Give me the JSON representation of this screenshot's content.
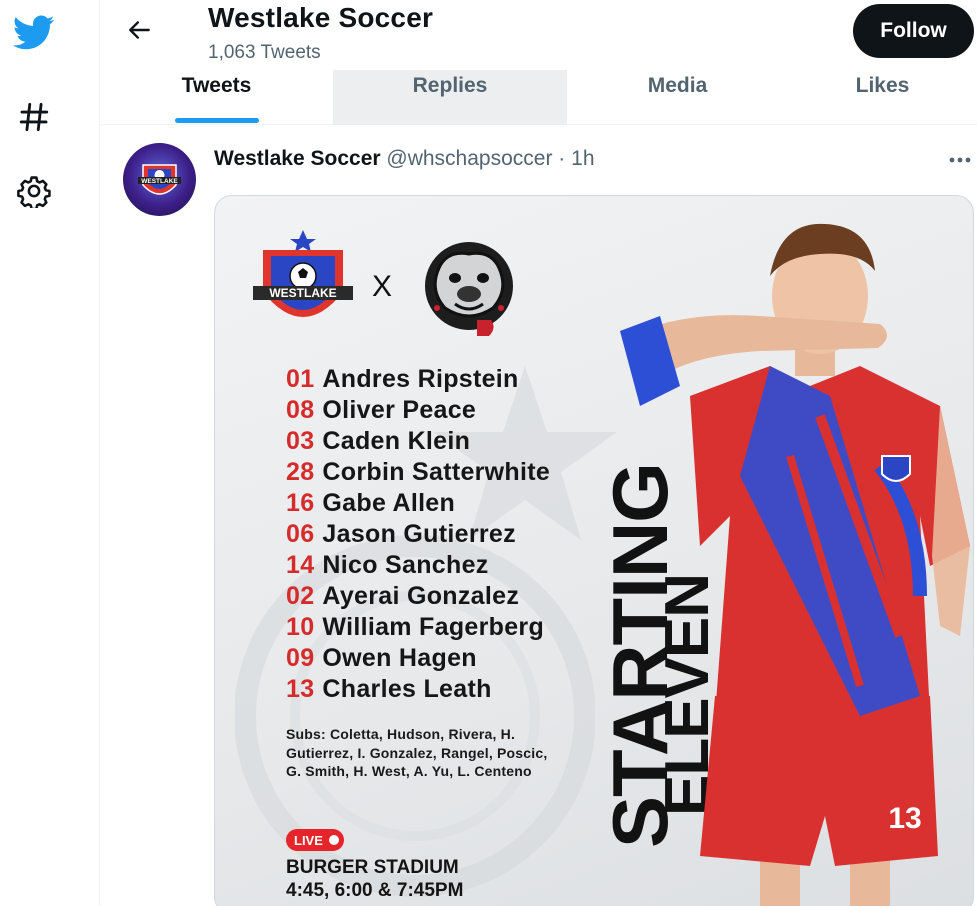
{
  "sidebar": {
    "items": [
      {
        "icon": "twitter-bird-icon"
      },
      {
        "icon": "hashtag-icon"
      },
      {
        "icon": "gear-icon"
      }
    ]
  },
  "header": {
    "title": "Westlake Soccer",
    "tweet_count": "1,063 Tweets",
    "follow_label": "Follow"
  },
  "tabs": [
    {
      "label": "Tweets"
    },
    {
      "label": "Replies"
    },
    {
      "label": "Media"
    },
    {
      "label": "Likes"
    }
  ],
  "tweet": {
    "name": "Westlake Soccer",
    "handle": "@whschapsoccer",
    "separator": "·",
    "time": "1h",
    "media": {
      "logo_text": "WESTLAKE",
      "vs": "X",
      "roster": [
        {
          "num": "01",
          "name": "Andres Ripstein"
        },
        {
          "num": "08",
          "name": "Oliver Peace"
        },
        {
          "num": "03",
          "name": "Caden Klein"
        },
        {
          "num": "28",
          "name": "Corbin Satterwhite"
        },
        {
          "num": "16",
          "name": "Gabe Allen"
        },
        {
          "num": "06",
          "name": "Jason Gutierrez"
        },
        {
          "num": "14",
          "name": "Nico Sanchez"
        },
        {
          "num": "02",
          "name": "Ayerai Gonzalez"
        },
        {
          "num": "10",
          "name": "William Fagerberg"
        },
        {
          "num": "09",
          "name": "Owen Hagen"
        },
        {
          "num": "13",
          "name": "Charles Leath"
        }
      ],
      "subs": "Subs: Coletta, Hudson, Rivera, H. Gutierrez, I. Gonzalez, Rangel, Poscic, G. Smith, H. West, A. Yu, L. Centeno",
      "live_label": "LIVE",
      "stadium": "BURGER STADIUM",
      "times": "4:45, 6:00 & 7:45PM",
      "headline_1": "STARTING",
      "headline_2": "ELEVEN",
      "jersey_number": "13"
    }
  },
  "colors": {
    "brand": "#1d9bf0",
    "follow_bg": "#0f1419",
    "roster_number": "#d62b2b",
    "live": "#e6252a",
    "jersey_red": "#d9312f",
    "jersey_blue": "#2d4fd6"
  }
}
